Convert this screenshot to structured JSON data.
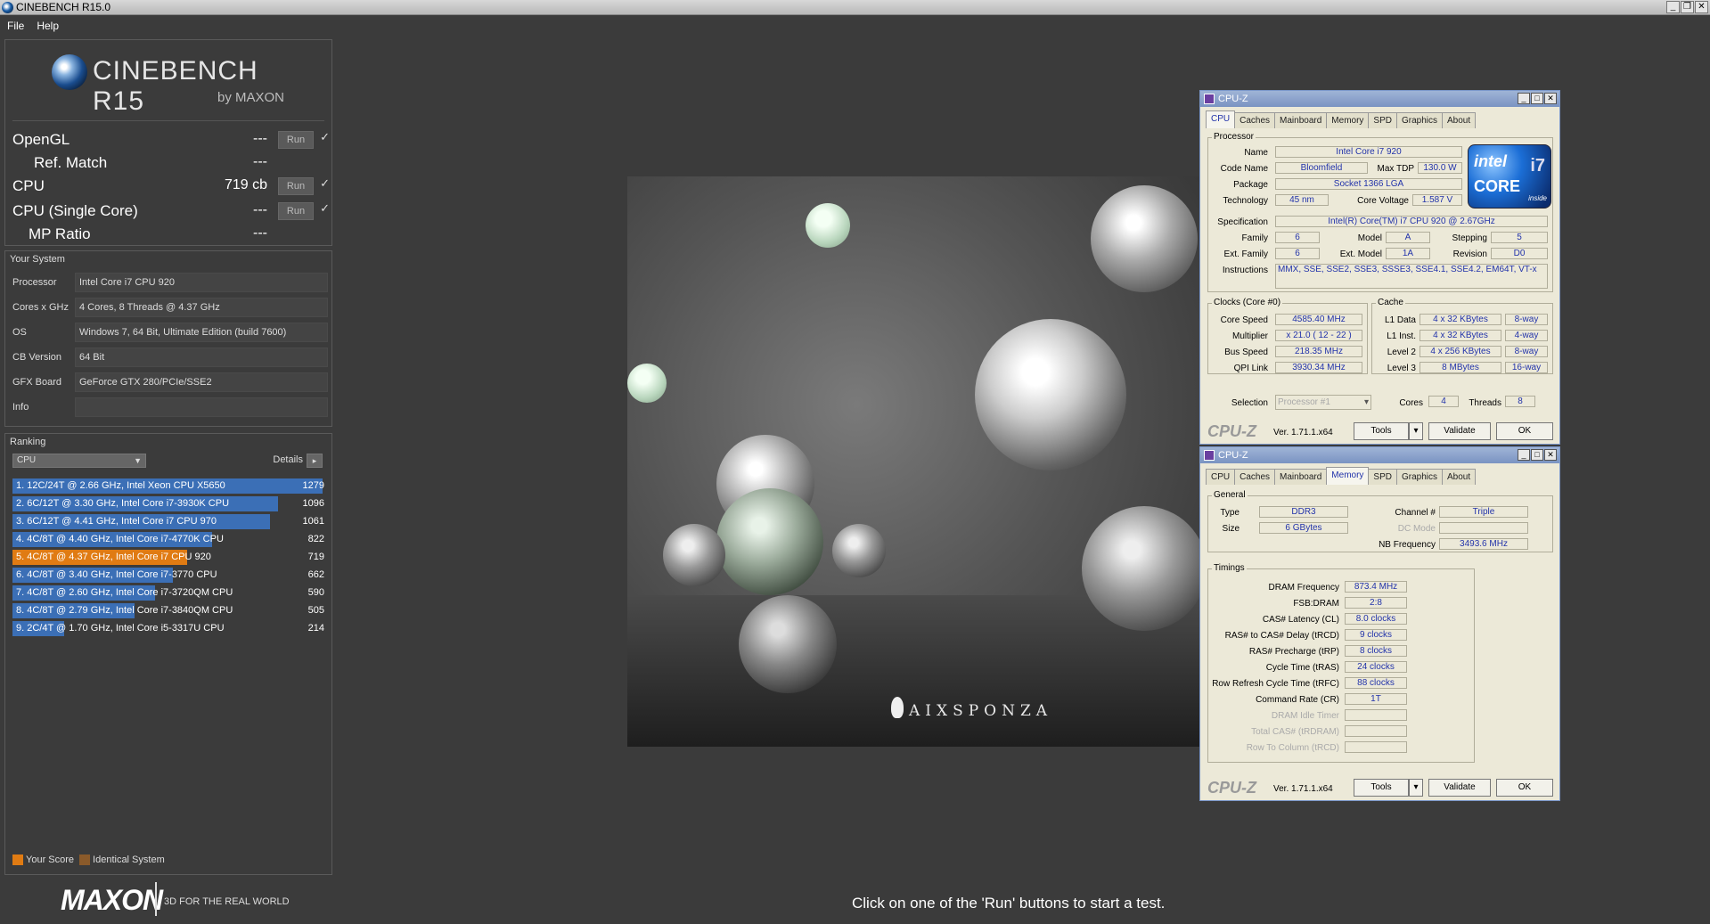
{
  "window": {
    "title": "CINEBENCH R15.0"
  },
  "menu": [
    "File",
    "Help"
  ],
  "logo": {
    "name": "CINEBENCH R15",
    "by": "by MAXON"
  },
  "bench": [
    {
      "label": "OpenGL",
      "value": "---",
      "run": "Run",
      "check": "✓"
    },
    {
      "label": "Ref. Match",
      "value": "---"
    },
    {
      "label": "CPU",
      "value": "719 cb",
      "run": "Run",
      "check": "✓"
    },
    {
      "label": "CPU (Single Core)",
      "value": "---",
      "run": "Run",
      "check": "✓"
    },
    {
      "label": "MP Ratio",
      "value": "---"
    }
  ],
  "system": {
    "title": "Your System",
    "rows": [
      {
        "k": "Processor",
        "v": "Intel Core i7 CPU 920"
      },
      {
        "k": "Cores x GHz",
        "v": "4 Cores, 8 Threads @ 4.37 GHz"
      },
      {
        "k": "OS",
        "v": "Windows 7, 64 Bit, Ultimate Edition (build 7600)"
      },
      {
        "k": "CB Version",
        "v": "64 Bit"
      },
      {
        "k": "GFX Board",
        "v": "GeForce GTX 280/PCIe/SSE2"
      },
      {
        "k": "Info",
        "v": ""
      }
    ]
  },
  "ranking": {
    "title": "Ranking",
    "select": "CPU",
    "details": "Details",
    "rows": [
      {
        "text": "1. 12C/24T @ 2.66 GHz, Intel Xeon CPU X5650",
        "score": "1279",
        "fraction": 1.0,
        "color": "#3b6fb6"
      },
      {
        "text": "2. 6C/12T @ 3.30 GHz,  Intel Core i7-3930K CPU",
        "score": "1096",
        "fraction": 0.857,
        "color": "#3b6fb6"
      },
      {
        "text": "3. 6C/12T @ 4.41 GHz, Intel Core i7 CPU 970",
        "score": "1061",
        "fraction": 0.83,
        "color": "#3b6fb6"
      },
      {
        "text": "4. 4C/8T @ 4.40 GHz, Intel Core i7-4770K CPU",
        "score": "822",
        "fraction": 0.643,
        "color": "#3b6fb6"
      },
      {
        "text": "5. 4C/8T @ 4.37 GHz, Intel Core i7 CPU 920",
        "score": "719",
        "fraction": 0.562,
        "color": "#e07b13"
      },
      {
        "text": "6. 4C/8T @ 3.40 GHz,  Intel Core i7-3770 CPU",
        "score": "662",
        "fraction": 0.518,
        "color": "#3b6fb6"
      },
      {
        "text": "7. 4C/8T @ 2.60 GHz,  Intel Core i7-3720QM CPU",
        "score": "590",
        "fraction": 0.461,
        "color": "#3b6fb6"
      },
      {
        "text": "8. 4C/8T @ 2.79 GHz,  Intel Core i7-3840QM CPU",
        "score": "505",
        "fraction": 0.395,
        "color": "#3b6fb6"
      },
      {
        "text": "9. 2C/4T @ 1.70 GHz,  Intel Core i5-3317U CPU",
        "score": "214",
        "fraction": 0.167,
        "color": "#3b6fb6"
      }
    ],
    "legend": [
      {
        "label": "Your Score",
        "color": "#e07b13"
      },
      {
        "label": "Identical System",
        "color": "#8a5a2a"
      }
    ]
  },
  "maxon": {
    "brand": "MAXON",
    "tagline": "3D FOR THE REAL WORLD"
  },
  "render": {
    "watermark": "AIXSPONZA"
  },
  "status": "Click on one of the 'Run' buttons to start a test.",
  "cpuz1": {
    "title": "CPU-Z",
    "tabs": [
      "CPU",
      "Caches",
      "Mainboard",
      "Memory",
      "SPD",
      "Graphics",
      "About"
    ],
    "active": "CPU",
    "processor_title": "Processor",
    "name_lbl": "Name",
    "name": "Intel Core i7 920",
    "codename_lbl": "Code Name",
    "codename": "Bloomfield",
    "maxtdp_lbl": "Max TDP",
    "maxtdp": "130.0 W",
    "package_lbl": "Package",
    "package": "Socket 1366 LGA",
    "tech_lbl": "Technology",
    "tech": "45 nm",
    "voltage_lbl": "Core Voltage",
    "voltage": "1.587 V",
    "spec_lbl": "Specification",
    "spec": "Intel(R) Core(TM) i7 CPU       920  @ 2.67GHz",
    "family_lbl": "Family",
    "family": "6",
    "model_lbl": "Model",
    "model": "A",
    "stepping_lbl": "Stepping",
    "stepping": "5",
    "extfamily_lbl": "Ext. Family",
    "extfamily": "6",
    "extmodel_lbl": "Ext. Model",
    "extmodel": "1A",
    "revision_lbl": "Revision",
    "revision": "D0",
    "instr_lbl": "Instructions",
    "instr": "MMX, SSE, SSE2, SSE3, SSSE3, SSE4.1, SSE4.2, EM64T, VT-x",
    "clocks_title": "Clocks (Core #0)",
    "corespeed_lbl": "Core Speed",
    "corespeed": "4585.40 MHz",
    "mult_lbl": "Multiplier",
    "mult": "x 21.0 ( 12 - 22 )",
    "bus_lbl": "Bus Speed",
    "bus": "218.35 MHz",
    "qpi_lbl": "QPI Link",
    "qpi": "3930.34 MHz",
    "cache_title": "Cache",
    "l1d_lbl": "L1 Data",
    "l1d": "4 x 32 KBytes",
    "l1d_way": "8-way",
    "l1i_lbl": "L1 Inst.",
    "l1i": "4 x 32 KBytes",
    "l1i_way": "4-way",
    "l2_lbl": "Level 2",
    "l2": "4 x 256 KBytes",
    "l2_way": "8-way",
    "l3_lbl": "Level 3",
    "l3": "8 MBytes",
    "l3_way": "16-way",
    "selection_lbl": "Selection",
    "selection": "Processor #1",
    "cores_lbl": "Cores",
    "cores": "4",
    "threads_lbl": "Threads",
    "threads": "8",
    "intel_logo": "intel",
    "intel_core": "CORE",
    "intel_i7": "i7",
    "intel_inside": "inside",
    "brand": "CPU-Z",
    "version": "Ver. 1.71.1.x64",
    "tools": "Tools",
    "validate": "Validate",
    "ok": "OK"
  },
  "cpuz2": {
    "title": "CPU-Z",
    "tabs": [
      "CPU",
      "Caches",
      "Mainboard",
      "Memory",
      "SPD",
      "Graphics",
      "About"
    ],
    "active": "Memory",
    "general_title": "General",
    "type_lbl": "Type",
    "type": "DDR3",
    "size_lbl": "Size",
    "size": "6 GBytes",
    "channel_lbl": "Channel #",
    "channel": "Triple",
    "dcmode_lbl": "DC Mode",
    "dcmode": "",
    "nbfreq_lbl": "NB Frequency",
    "nbfreq": "3493.6 MHz",
    "timings_title": "Timings",
    "timings": [
      {
        "k": "DRAM Frequency",
        "v": "873.4 MHz",
        "dis": false
      },
      {
        "k": "FSB:DRAM",
        "v": "2:8",
        "dis": false
      },
      {
        "k": "CAS# Latency (CL)",
        "v": "8.0 clocks",
        "dis": false
      },
      {
        "k": "RAS# to CAS# Delay (tRCD)",
        "v": "9 clocks",
        "dis": false
      },
      {
        "k": "RAS# Precharge (tRP)",
        "v": "8 clocks",
        "dis": false
      },
      {
        "k": "Cycle Time (tRAS)",
        "v": "24 clocks",
        "dis": false
      },
      {
        "k": "Row Refresh Cycle Time (tRFC)",
        "v": "88 clocks",
        "dis": false
      },
      {
        "k": "Command Rate (CR)",
        "v": "1T",
        "dis": false
      },
      {
        "k": "DRAM Idle Timer",
        "v": "",
        "dis": true
      },
      {
        "k": "Total CAS# (tRDRAM)",
        "v": "",
        "dis": true
      },
      {
        "k": "Row To Column (tRCD)",
        "v": "",
        "dis": true
      }
    ],
    "brand": "CPU-Z",
    "version": "Ver. 1.71.1.x64",
    "tools": "Tools",
    "validate": "Validate",
    "ok": "OK"
  }
}
